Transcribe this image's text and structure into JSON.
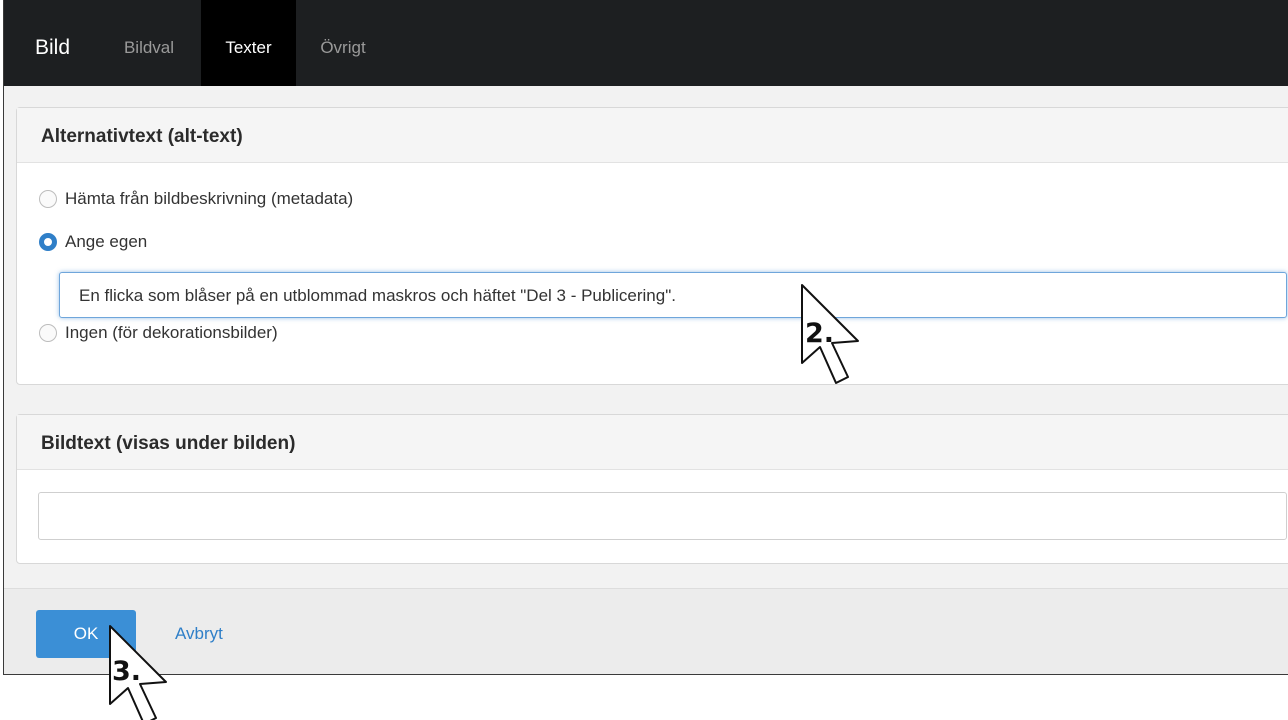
{
  "app": {
    "title": "Bild"
  },
  "tabs": [
    {
      "label": "Bildval",
      "active": false
    },
    {
      "label": "Texter",
      "active": true
    },
    {
      "label": "Övrigt",
      "active": false
    }
  ],
  "alt_panel": {
    "title": "Alternativtext (alt-text)",
    "options": [
      {
        "label": "Hämta från bildbeskrivning (metadata)",
        "checked": false
      },
      {
        "label": "Ange egen",
        "checked": true
      },
      {
        "label": "Ingen (för dekorationsbilder)",
        "checked": false
      }
    ],
    "input_value": "En flicka som blåser på en utblommad maskros och häftet \"Del 3 - Publicering\"."
  },
  "caption_panel": {
    "title": "Bildtext (visas under bilden)",
    "input_value": ""
  },
  "footer": {
    "ok_label": "OK",
    "cancel_label": "Avbryt"
  },
  "annotations": {
    "step2": "2.",
    "step3": "3."
  },
  "colors": {
    "topbar": "#1d1f21",
    "accent": "#2f7fc8",
    "ok_button": "#3b8fd6"
  }
}
